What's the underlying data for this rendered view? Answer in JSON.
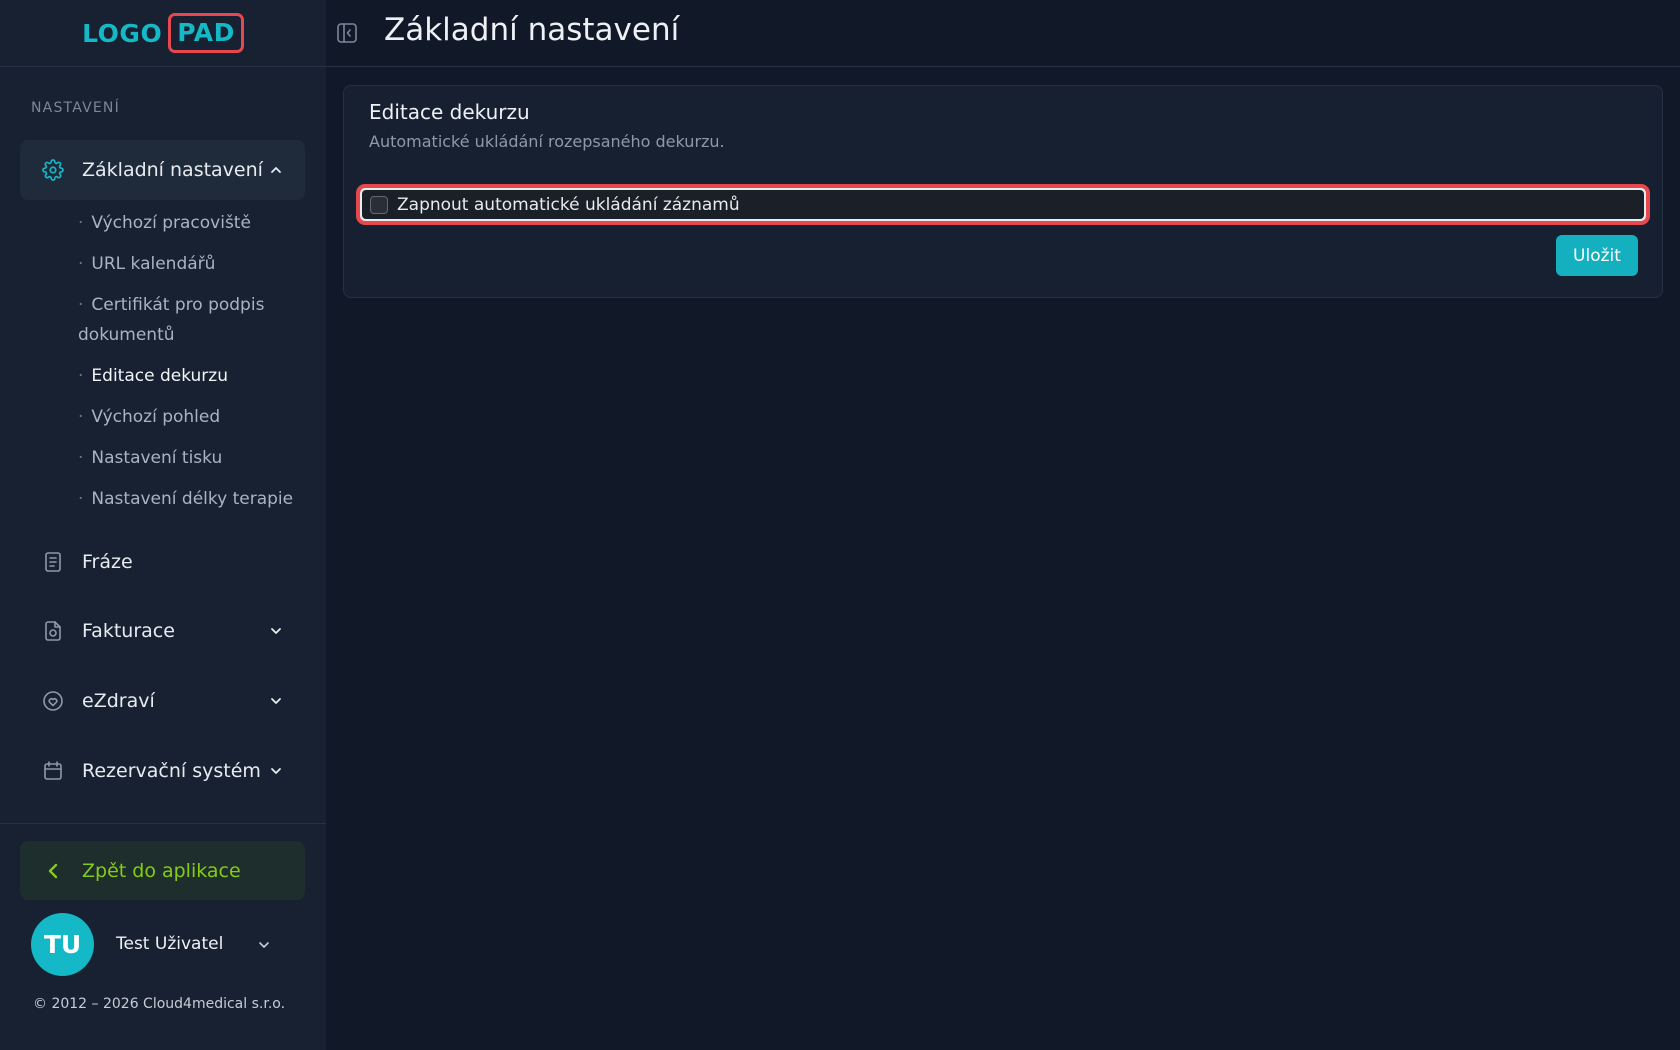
{
  "logo": {
    "part1": "LOGO",
    "part2": "PAD"
  },
  "sidebar": {
    "section_label": "NASTAVENÍ",
    "active_group": {
      "label": "Základní nastavení",
      "icon": "gear-icon"
    },
    "sub_items": [
      {
        "label": "Výchozí pracoviště"
      },
      {
        "label": "URL kalendářů"
      },
      {
        "label": "Certifikát pro podpis dokumentů"
      },
      {
        "label": "Editace dekurzu",
        "active": true
      },
      {
        "label": "Výchozí pohled"
      },
      {
        "label": "Nastavení tisku"
      },
      {
        "label": "Nastavení délky terapie"
      }
    ],
    "items": [
      {
        "label": "Fráze",
        "icon": "document-icon"
      },
      {
        "label": "Fakturace",
        "icon": "invoice-icon"
      },
      {
        "label": "eZdraví",
        "icon": "heart-icon"
      },
      {
        "label": "Rezervační systém",
        "icon": "calendar-icon"
      }
    ],
    "back_label": "Zpět do aplikace",
    "user": {
      "initials": "TU",
      "name": "Test Uživatel"
    },
    "copyright": "© 2012 – 2026 Cloud4medical s.r.o."
  },
  "header": {
    "title": "Základní nastavení"
  },
  "card": {
    "title": "Editace dekurzu",
    "description": "Automatické ukládání rozepsaného dekurzu.",
    "checkbox_label": "Zapnout automatické ukládání záznamů",
    "checkbox_checked": false,
    "save_label": "Uložit"
  },
  "colors": {
    "accent": "#14b8c6",
    "highlight": "#e5484d",
    "back_link": "#84cc16"
  }
}
